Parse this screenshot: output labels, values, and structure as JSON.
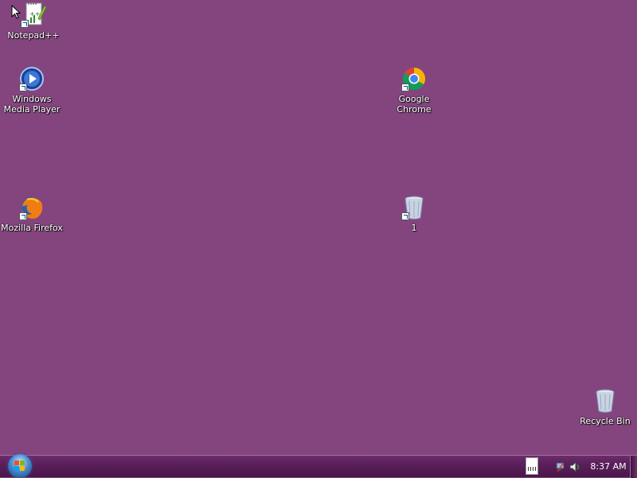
{
  "desktop": {
    "background_color": "#84457f",
    "icons": [
      {
        "label": "Notepad++",
        "icon": "notepad-plus-plus-icon",
        "shortcut": true
      },
      {
        "label": "Windows\nMedia Player",
        "icon": "windows-media-player-icon",
        "shortcut": true
      },
      {
        "label": "Mozilla Firefox",
        "icon": "firefox-icon",
        "shortcut": true
      },
      {
        "label": "Google\nChrome",
        "icon": "chrome-icon",
        "shortcut": true
      },
      {
        "label": "1",
        "icon": "recycle-bin-icon",
        "shortcut": true
      },
      {
        "label": "Recycle Bin",
        "icon": "recycle-bin-icon",
        "shortcut": false
      }
    ]
  },
  "taskbar": {
    "start_button": "start-orb-icon",
    "tray_icons": [
      "keyboard-icon",
      "network-icon",
      "volume-icon"
    ],
    "clock": "8:37 AM"
  }
}
